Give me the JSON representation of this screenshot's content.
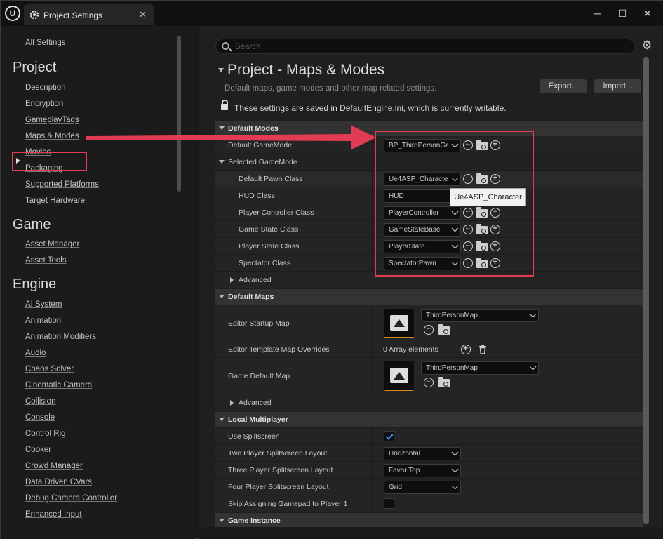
{
  "window": {
    "tab_title": "Project Settings",
    "tab_close": "✕",
    "minimize": "─",
    "maximize": "☐",
    "close": "✕",
    "logo": "U"
  },
  "sidebar": {
    "all_settings": "All Settings",
    "sections": [
      {
        "title": "Project",
        "items": [
          "Description",
          "Encryption",
          "GameplayTags",
          "Maps & Modes",
          "Movies",
          "Packaging",
          "Supported Platforms",
          "Target Hardware"
        ]
      },
      {
        "title": "Game",
        "items": [
          "Asset Manager",
          "Asset Tools"
        ]
      },
      {
        "title": "Engine",
        "items": [
          "AI System",
          "Animation",
          "Animation Modifiers",
          "Audio",
          "Chaos Solver",
          "Cinematic Camera",
          "Collision",
          "Console",
          "Control Rig",
          "Cooker",
          "Crowd Manager",
          "Data Driven CVars",
          "Debug Camera Controller",
          "Enhanced Input"
        ]
      }
    ],
    "active_item": "Maps & Modes"
  },
  "search": {
    "placeholder": "Search",
    "value": ""
  },
  "header": {
    "title": "Project - Maps & Modes",
    "subtitle": "Default maps, game modes and other map related settings.",
    "export_label": "Export...",
    "import_label": "Import...",
    "save_note": "These settings are saved in DefaultEngine.ini, which is currently writable."
  },
  "default_modes": {
    "category": "Default Modes",
    "default_gamemode_label": "Default GameMode",
    "default_gamemode_value": "BP_ThirdPersonGameMode",
    "selected_gamemode": "Selected GameMode",
    "rows": [
      {
        "label": "Default Pawn Class",
        "value": "Ue4ASP_Character"
      },
      {
        "label": "HUD Class",
        "value": "HUD"
      },
      {
        "label": "Player Controller Class",
        "value": "PlayerController"
      },
      {
        "label": "Game State Class",
        "value": "GameStateBase"
      },
      {
        "label": "Player State Class",
        "value": "PlayerState"
      },
      {
        "label": "Spectator Class",
        "value": "SpectatorPawn"
      }
    ],
    "advanced": "Advanced",
    "tooltip": "Ue4ASP_Character"
  },
  "default_maps": {
    "category": "Default Maps",
    "editor_startup_label": "Editor Startup Map",
    "editor_startup_value": "ThirdPersonMap",
    "template_overrides_label": "Editor Template Map Overrides",
    "template_overrides_value": "0 Array elements",
    "game_default_label": "Game Default Map",
    "game_default_value": "ThirdPersonMap",
    "advanced": "Advanced"
  },
  "local_multiplayer": {
    "category": "Local Multiplayer",
    "use_splitscreen_label": "Use Splitscreen",
    "use_splitscreen_checked": true,
    "two_player_label": "Two Player Splitscreen Layout",
    "two_player_value": "Horizontal",
    "three_player_label": "Three Player Splitscreen Layout",
    "three_player_value": "Favor Top",
    "four_player_label": "Four Player Splitscreen Layout",
    "four_player_value": "Grid",
    "skip_gamepad_label": "Skip Assigning Gamepad to Player 1",
    "skip_gamepad_checked": false
  },
  "game_instance": {
    "category": "Game Instance"
  },
  "colors": {
    "annotation": "#e23c54",
    "accent": "#d8861d",
    "check": "#3d8bf0"
  }
}
